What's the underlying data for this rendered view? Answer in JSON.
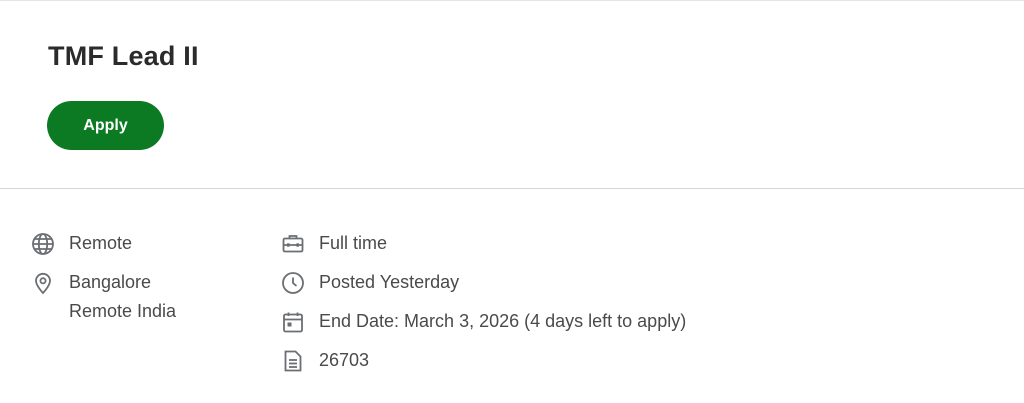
{
  "job": {
    "title": "TMF Lead II",
    "apply_label": "Apply"
  },
  "details_left": {
    "work_type": "Remote",
    "location_line1": "Bangalore",
    "location_line2": "Remote India"
  },
  "details_right": {
    "employment_type": "Full time",
    "posted": "Posted Yesterday",
    "end_date": "End Date: March 3, 2026 (4 days left to apply)",
    "job_id": "26703"
  },
  "icons": {
    "work_type": "globe-icon",
    "location": "location-pin-icon",
    "employment_type": "briefcase-icon",
    "posted": "clock-icon",
    "end_date": "calendar-icon",
    "job_id": "document-icon"
  },
  "colors": {
    "apply_bg": "#0b7a23",
    "icon": "#6b6e72"
  }
}
